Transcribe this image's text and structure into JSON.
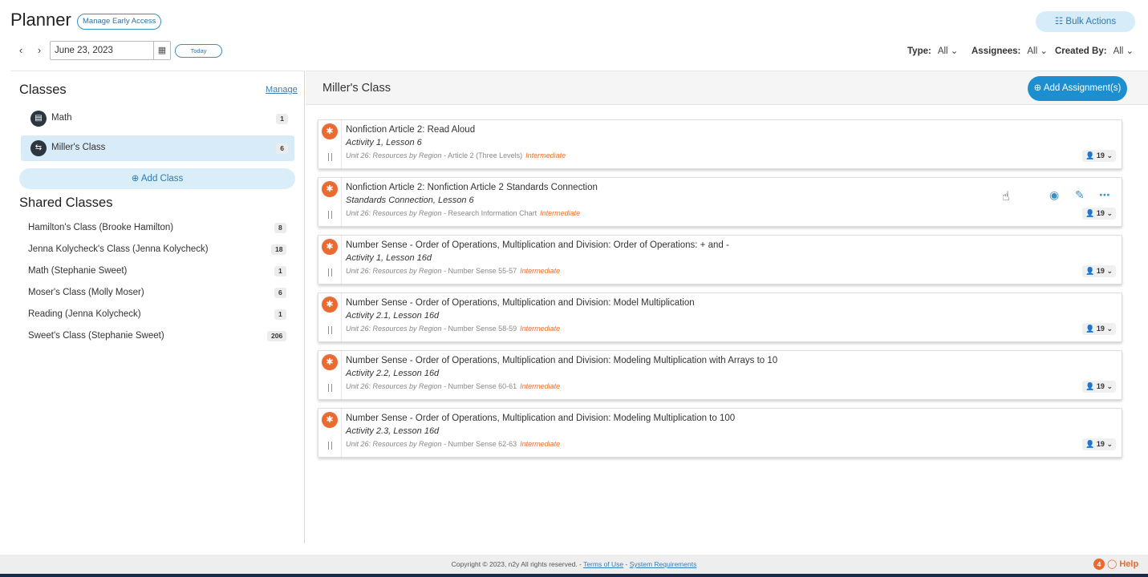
{
  "header": {
    "title": "Planner",
    "early_access": "Manage Early Access",
    "bulk_actions": "☷ Bulk Actions",
    "date_value": "June 23, 2023",
    "today": "Today",
    "prev_icon": "‹",
    "next_icon": "›",
    "calendar_icon": "▦"
  },
  "filters": [
    {
      "label": "Type:",
      "value": "All ⌄"
    },
    {
      "label": "Assignees:",
      "value": "All ⌄"
    },
    {
      "label": "Created By:",
      "value": "All ⌄"
    }
  ],
  "sidebar": {
    "classes_heading": "Classes",
    "manage": "Manage",
    "classes": [
      {
        "name": "Math",
        "count": "1",
        "icon": "▤"
      },
      {
        "name": "Miller's Class",
        "count": "6",
        "icon": "⇆"
      }
    ],
    "add_class": "⊕ Add Class",
    "shared_heading": "Shared Classes",
    "shared": [
      {
        "name": "Hamilton's Class (Brooke Hamilton)",
        "count": "8"
      },
      {
        "name": "Jenna Kolycheck's Class (Jenna Kolycheck)",
        "count": "18"
      },
      {
        "name": "Math (Stephanie Sweet)",
        "count": "1"
      },
      {
        "name": "Moser's Class (Molly Moser)",
        "count": "6"
      },
      {
        "name": "Reading (Jenna Kolycheck)",
        "count": "1"
      },
      {
        "name": "Sweet's Class (Stephanie Sweet)",
        "count": "206"
      }
    ]
  },
  "main": {
    "title": "Miller's Class",
    "add_assignment": "⊕ Add Assignment(s)",
    "cards": [
      {
        "title": "Nonfiction Article 2: Read Aloud",
        "sub": "Activity 1, Lesson 6",
        "unit": "Unit 26: Resources by Region",
        "resource": " - Article 2 (Three Levels)",
        "level": "Intermediate",
        "assignees": "19"
      },
      {
        "title": "Nonfiction Article 2: Nonfiction Article 2 Standards Connection",
        "sub": "Standards Connection, Lesson 6",
        "unit": "Unit 26: Resources by Region",
        "resource": " - Research Information Chart",
        "level": "Intermediate",
        "assignees": "19"
      },
      {
        "title": "Number Sense - Order of Operations, Multiplication and Division: Order of Operations: + and -",
        "sub": "Activity 1, Lesson 16d",
        "unit": "Unit 26: Resources by Region",
        "resource": " - Number Sense 55-57",
        "level": "Intermediate",
        "assignees": "19"
      },
      {
        "title": "Number Sense - Order of Operations, Multiplication and Division: Model Multiplication",
        "sub": "Activity 2.1, Lesson 16d",
        "unit": "Unit 26: Resources by Region",
        "resource": " - Number Sense 58-59",
        "level": "Intermediate",
        "assignees": "19"
      },
      {
        "title": "Number Sense - Order of Operations, Multiplication and Division: Modeling Multiplication with Arrays to 10",
        "sub": "Activity 2.2, Lesson 16d",
        "unit": "Unit 26: Resources by Region",
        "resource": " - Number Sense 60-61",
        "level": "Intermediate",
        "assignees": "19"
      },
      {
        "title": "Number Sense - Order of Operations, Multiplication and Division: Modeling Multiplication to 100",
        "sub": "Activity 2.3, Lesson 16d",
        "unit": "Unit 26: Resources by Region",
        "resource": " - Number Sense 62-63",
        "level": "Intermediate",
        "assignees": "19"
      }
    ],
    "card_actions": {
      "view_icon": "◉",
      "edit_icon": "✎",
      "more_icon": "⋯"
    },
    "assignee_chevron": "⌄",
    "person_icon": "👤"
  },
  "footer": {
    "copyright": "Copyright © 2023, n2y All rights reserved. - ",
    "terms": "Terms of Use",
    "sep": " - ",
    "system": "System Requirements",
    "help_count": "4",
    "help": "◯ Help"
  },
  "colors": {
    "accent": "#1d8fd0",
    "brand_orange": "#ea6a2f",
    "active_row": "#d7ecf8"
  }
}
